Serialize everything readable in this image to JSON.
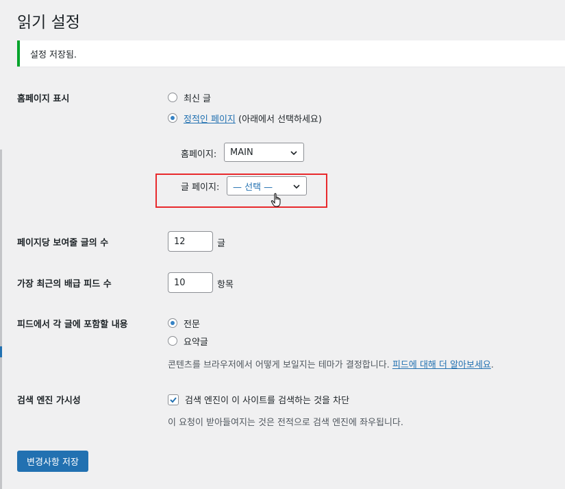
{
  "page": {
    "title": "읽기 설정"
  },
  "notice": {
    "text": "설정 저장됨."
  },
  "homepage_display": {
    "label": "홈페이지 표시",
    "option_latest": "최신 글",
    "option_static_link": "정적인 페이지",
    "option_static_suffix": " (아래에서 선택하세요)",
    "selected": "static",
    "homepage_label": "홈페이지:",
    "homepage_value": "MAIN",
    "posts_page_label": "글 페이지:",
    "posts_page_value": "— 선택 —"
  },
  "posts_per_page": {
    "label": "페이지당 보여줄 글의 수",
    "value": "12",
    "unit": "글"
  },
  "feed_items": {
    "label": "가장 최근의 배급 피드 수",
    "value": "10",
    "unit": "항목"
  },
  "feed_content": {
    "label": "피드에서 각 글에 포함할 내용",
    "option_full": "전문",
    "option_excerpt": "요약글",
    "selected": "full",
    "desc_prefix": "콘텐츠를 브라우저에서 어떻게 보일지는 테마가 결정합니다. ",
    "desc_link": "피드에 대해 더 알아보세요",
    "desc_suffix": "."
  },
  "search_visibility": {
    "label": "검색 엔진 가시성",
    "checkbox_label": "검색 엔진이 이 사이트를 검색하는 것을 차단",
    "checked": true,
    "desc": "이 요청이 받아들여지는 것은 전적으로 검색 엔진에 좌우됩니다."
  },
  "actions": {
    "save_label": "변경사항 저장"
  },
  "colors": {
    "accent": "#2271b1",
    "success": "#00a32a",
    "highlight": "#e8282b"
  },
  "icons": {
    "select_arrow": "chevron-down-icon",
    "cursor": "hand-cursor-icon",
    "check": "check-icon"
  }
}
